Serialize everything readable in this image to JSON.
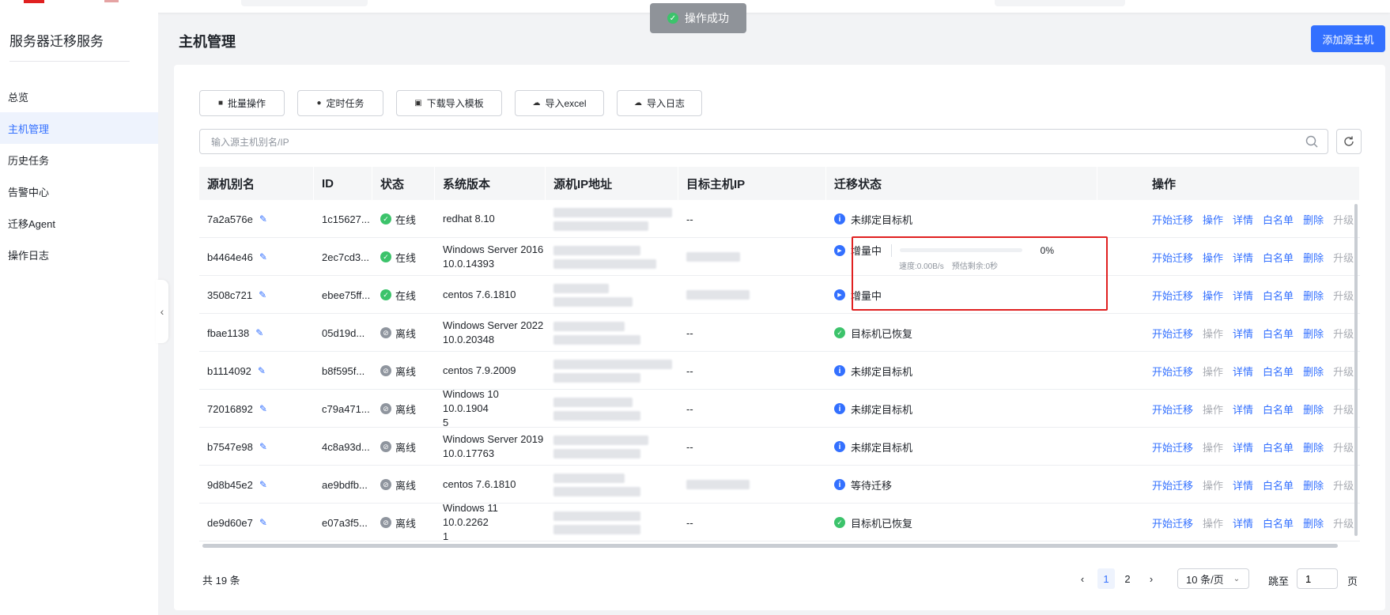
{
  "toast": {
    "text": "操作成功"
  },
  "sidebar": {
    "title": "服务器迁移服务",
    "items": [
      {
        "label": "总览",
        "active": false
      },
      {
        "label": "主机管理",
        "active": true
      },
      {
        "label": "历史任务",
        "active": false
      },
      {
        "label": "告警中心",
        "active": false
      },
      {
        "label": "迁移Agent",
        "active": false
      },
      {
        "label": "操作日志",
        "active": false
      }
    ]
  },
  "header": {
    "title": "主机管理",
    "add_button": "添加源主机"
  },
  "toolbar": {
    "batch": "批量操作",
    "schedule": "定时任务",
    "download_template": "下载导入模板",
    "import_excel": "导入excel",
    "import_log": "导入日志"
  },
  "search": {
    "placeholder": "输入源主机别名/IP",
    "value": ""
  },
  "table": {
    "columns": [
      "源机别名",
      "ID",
      "状态",
      "系统版本",
      "源机IP地址",
      "目标主机IP",
      "迁移状态",
      "操作"
    ],
    "rows": [
      {
        "alias": "7a2a576e",
        "id": "1c15627...",
        "status": "在线",
        "online": true,
        "os1": "redhat 8.10",
        "os2": "",
        "target": "--",
        "migration": "未绑定目标机",
        "mig_type": "info",
        "op_enabled": true
      },
      {
        "alias": "b4464e46",
        "id": "2ec7cd3...",
        "status": "在线",
        "online": true,
        "os1": "Windows Server 2016",
        "os2": "10.0.14393",
        "target": "",
        "migration": "增量中",
        "mig_type": "progress",
        "op_enabled": true
      },
      {
        "alias": "3508c721",
        "id": "ebee75ff...",
        "status": "在线",
        "online": true,
        "os1": "centos 7.6.1810",
        "os2": "",
        "target": "",
        "migration": "增量中",
        "mig_type": "play",
        "op_enabled": true
      },
      {
        "alias": "fbae1138",
        "id": "05d19d...",
        "status": "离线",
        "online": false,
        "os1": "Windows Server 2022",
        "os2": "10.0.20348",
        "target": "--",
        "migration": "目标机已恢复",
        "mig_type": "ok",
        "op_enabled": false
      },
      {
        "alias": "b1114092",
        "id": "b8f595f...",
        "status": "离线",
        "online": false,
        "os1": "centos 7.9.2009",
        "os2": "",
        "target": "--",
        "migration": "未绑定目标机",
        "mig_type": "info",
        "op_enabled": false
      },
      {
        "alias": "72016892",
        "id": "c79a471...",
        "status": "离线",
        "online": false,
        "os1": "Windows 10 10.0.1904",
        "os2": "5",
        "target": "--",
        "migration": "未绑定目标机",
        "mig_type": "info",
        "op_enabled": false
      },
      {
        "alias": "b7547e98",
        "id": "4c8a93d...",
        "status": "离线",
        "online": false,
        "os1": "Windows Server 2019",
        "os2": "10.0.17763",
        "target": "--",
        "migration": "未绑定目标机",
        "mig_type": "info",
        "op_enabled": false
      },
      {
        "alias": "9d8b45e2",
        "id": "ae9bdfb...",
        "status": "离线",
        "online": false,
        "os1": "centos 7.6.1810",
        "os2": "",
        "target": "",
        "migration": "等待迁移",
        "mig_type": "info",
        "op_enabled": false
      },
      {
        "alias": "de9d60e7",
        "id": "e07a3f5...",
        "status": "离线",
        "online": false,
        "os1": "Windows 11 10.0.2262",
        "os2": "1",
        "target": "--",
        "migration": "目标机已恢复",
        "mig_type": "ok",
        "op_enabled": false
      }
    ],
    "progress": {
      "percent_label": "0%",
      "percent": 0,
      "speed": "速度:0.00B/s",
      "remaining": "预估剩余:0秒"
    },
    "actions": [
      "开始迁移",
      "操作",
      "详情",
      "白名单",
      "删除",
      "升级"
    ]
  },
  "footer": {
    "total": "共 19 条",
    "pages": [
      "1",
      "2"
    ],
    "page_size": "10 条/页",
    "jump_label": "跳至",
    "jump_value": "1",
    "page_suffix": "页"
  }
}
